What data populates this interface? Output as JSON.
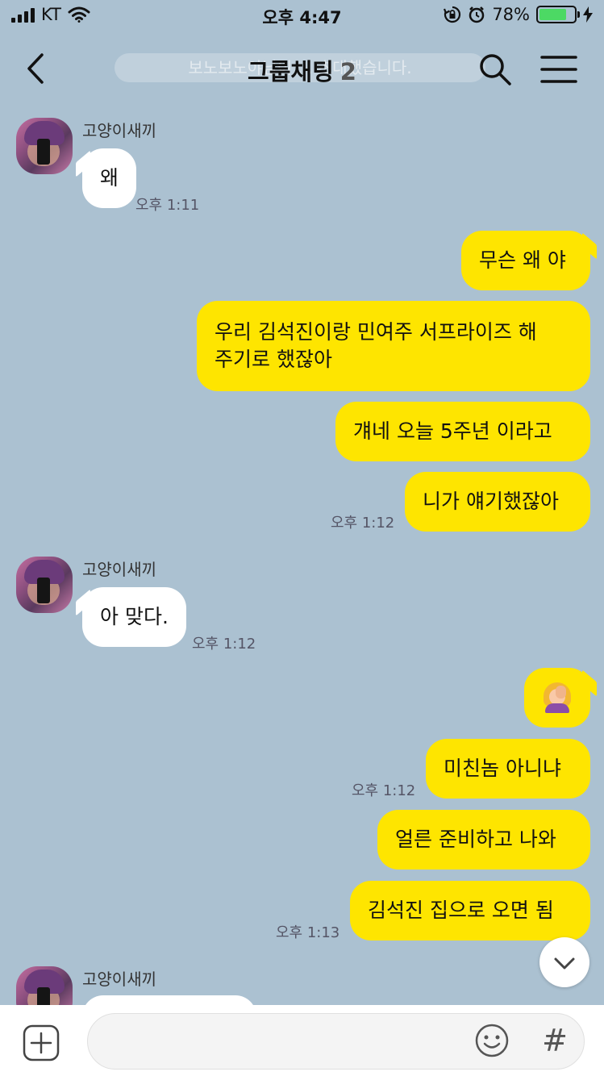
{
  "status_bar": {
    "carrier": "KT",
    "time": "오후 4:47",
    "battery_percent": "78%",
    "battery_level": 0.78
  },
  "header": {
    "title": "그룹채팅",
    "member_count": "2",
    "faded_notice": "보노보노야님이 ... 초대했습니다."
  },
  "icons": {
    "back": "chevron-left-icon",
    "search": "search-icon",
    "menu": "hamburger-menu-icon",
    "scroll_down": "chevron-down-icon",
    "add": "plus-square-icon",
    "emoji": "smiley-icon",
    "hashtag": "hash-icon"
  },
  "colors": {
    "chat_background": "#abc1d1",
    "outgoing_bubble": "#fee500",
    "incoming_bubble": "#ffffff"
  },
  "messages": [
    {
      "sender": "고양이새끼",
      "text": "왜",
      "time": "오후 1:11"
    },
    {
      "text": "무슨 왜 야"
    },
    {
      "line1": "우리 김석진이랑 민여주 서프라이즈 해",
      "line2": "주기로 했잖아"
    },
    {
      "text": "걔네 오늘 5주년 이라고"
    },
    {
      "text": "니가 얘기했잖아",
      "time": "오후 1:12"
    },
    {
      "sender": "고양이새끼",
      "text": "아 맞다.",
      "time": "오후 1:12"
    },
    {
      "emoji": "woman-facepalming"
    },
    {
      "text": "미친놈 아니냐",
      "time": "오후 1:12"
    },
    {
      "text": "얼른 준비하고 나와"
    },
    {
      "text": "김석진 집으로 오면 됨",
      "time": "오후 1:13"
    },
    {
      "sender": "고양이새끼"
    }
  ],
  "input": {
    "value": "",
    "hash_label": "#"
  }
}
